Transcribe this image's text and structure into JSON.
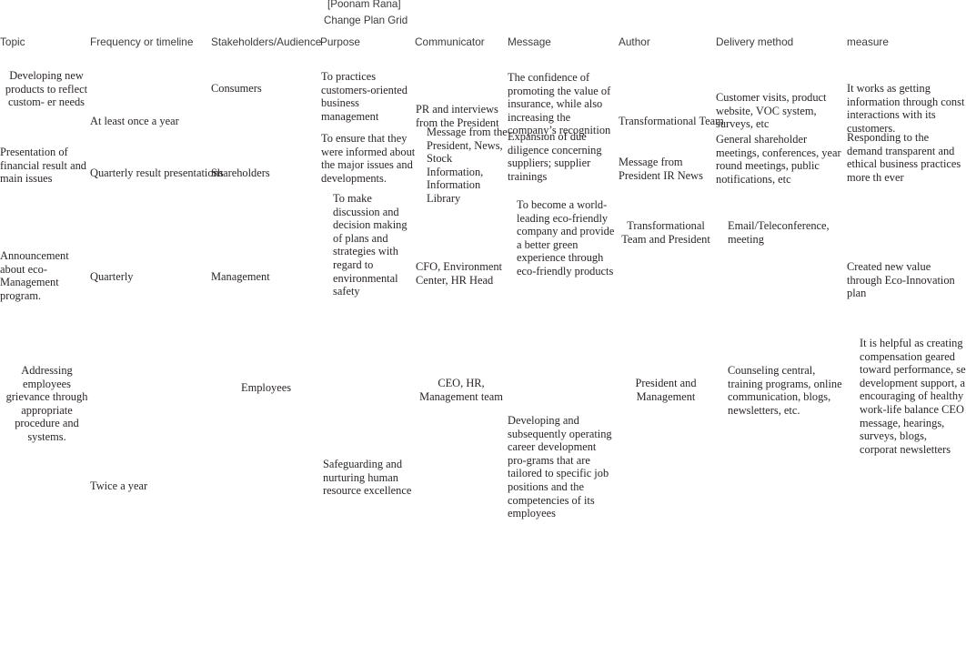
{
  "document": {
    "byline": "[Poonam Rana]",
    "title": "Change Plan Grid"
  },
  "table": {
    "columns": [
      {
        "key": "topic",
        "label": "Topic"
      },
      {
        "key": "frequency",
        "label": "Frequency or timeline"
      },
      {
        "key": "stakeholders",
        "label": "Stakeholders/Audience"
      },
      {
        "key": "purpose",
        "label": "Purpose"
      },
      {
        "key": "communicator",
        "label": "Communicator"
      },
      {
        "key": "message",
        "label": "Message"
      },
      {
        "key": "author",
        "label": "Author"
      },
      {
        "key": "delivery",
        "label": "Delivery method"
      },
      {
        "key": "measure",
        "label": "measure"
      }
    ],
    "rows": [
      {
        "topic": "Developing new products to reflect custom- er needs",
        "frequency": "At least once a year",
        "stakeholders": "Consumers",
        "purpose": "To practices customers-oriented business management",
        "communicator": "PR and interviews from the President",
        "message": "The confidence of promoting the value of insurance, while also increasing the company’s recognition",
        "author": "Transformational Team",
        "delivery": "Customer visits, product website, VOC system, surveys, etc",
        "measure": "It works as getting information through const interactions with its customers."
      },
      {
        "topic": "Presentation of financial result and main issues",
        "frequency": "Quarterly result presentations",
        "stakeholders": "Shareholders",
        "purpose": "To ensure that they were informed about the major issues and developments.",
        "communicator": "Message from the President, News, Stock Information, Information Library",
        "message": "Expansion of due diligence concerning suppliers; supplier trainings",
        "author": "Message from President IR News",
        "delivery": "General shareholder meetings, conferences, year round meetings, public notifications, etc",
        "measure": "Responding to the demand transparent and ethical business practices more th ever"
      },
      {
        "topic": "Announcement about eco-Management program.",
        "frequency": "Quarterly",
        "stakeholders": "Management",
        "purpose": "To make discussion and decision making of plans and strategies with regard to environmental safety",
        "communicator": "CFO, Environment Center, HR Head",
        "message": "To become a world-leading eco-friendly company and provide a better green experience through eco-friendly products",
        "author": "Transformational Team and President",
        "delivery": "Email/Teleconference, meeting",
        "measure": "Created new value through Eco-Innovation plan"
      },
      {
        "topic": "Addressing employees grievance through appropriate procedure and systems.",
        "frequency": "Twice a year",
        "stakeholders": "Employees",
        "purpose": "Safeguarding and nurturing human resource excellence",
        "communicator": "CEO, HR, Management team",
        "message": "Developing and subsequently operating career development pro-grams that are tailored to specific job positions and the competencies of its employees",
        "author": "President and Management",
        "delivery": "Counseling central, training programs, online communication, blogs, newsletters, etc.",
        "measure": "It is helpful as creating compensation geared toward performance, se development support, a encouraging of healthy work-life balance CEO message, hearings, surveys, blogs, corporat newsletters"
      }
    ]
  }
}
